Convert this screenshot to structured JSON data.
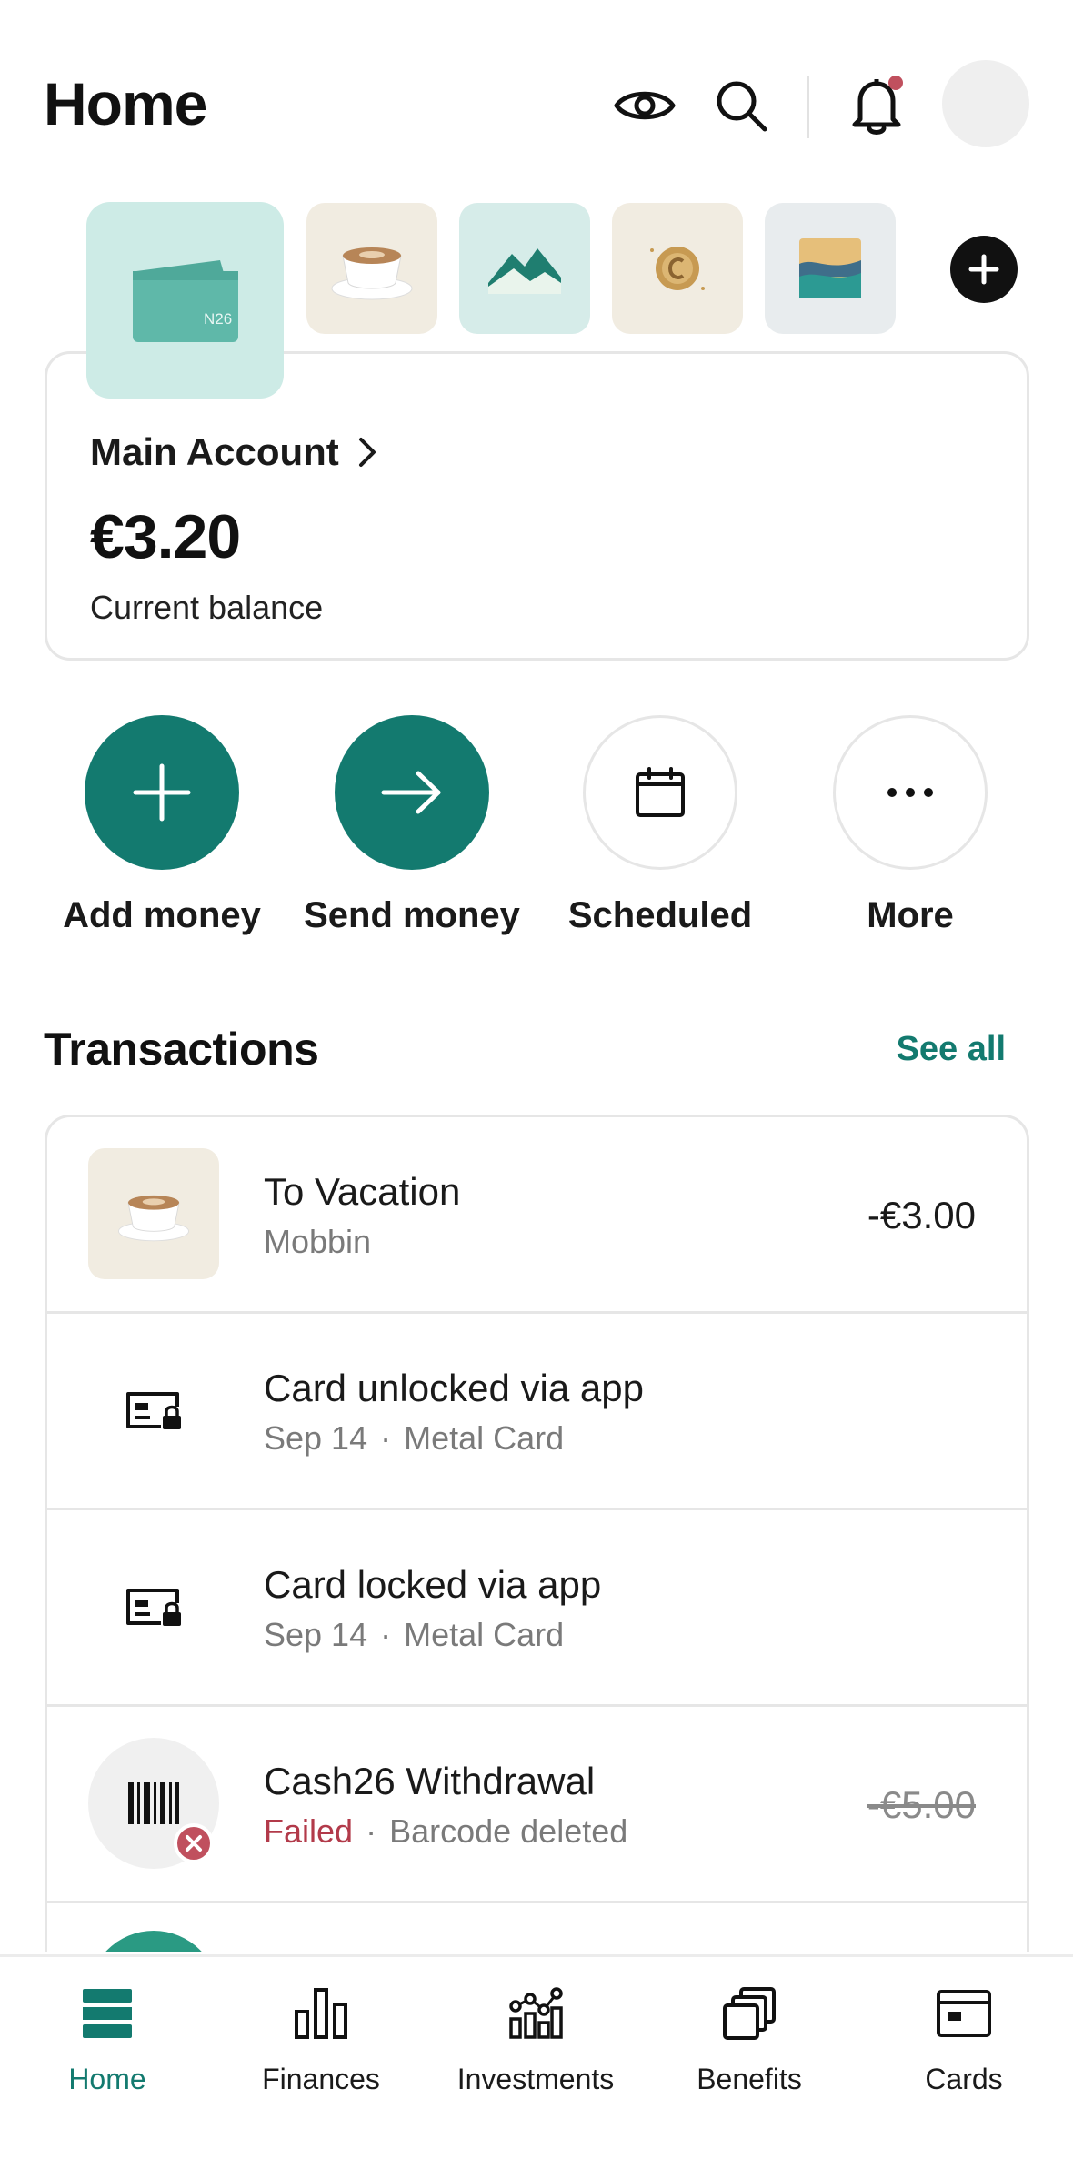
{
  "header": {
    "title": "Home",
    "icons": [
      "eye-icon",
      "search-icon",
      "bell-icon",
      "avatar"
    ],
    "notification_dot_color": "#c0505e"
  },
  "spaces": [
    {
      "name": "main-account",
      "icon": "wallet-icon",
      "bg": "#cdebe6",
      "wallet_mark": "N26"
    },
    {
      "name": "coffee",
      "icon": "coffee-cup-icon",
      "bg": "#f1ece1"
    },
    {
      "name": "mountains",
      "icon": "mountains-icon",
      "bg": "#d6ece9"
    },
    {
      "name": "coin",
      "icon": "coin-icon",
      "bg": "#f1ece1"
    },
    {
      "name": "landscape",
      "icon": "landscape-icon",
      "bg": "#e8ecee"
    }
  ],
  "account": {
    "name": "Main Account",
    "balance": "€3.20",
    "balance_label": "Current balance"
  },
  "actions": [
    {
      "label": "Add money",
      "icon": "plus-icon"
    },
    {
      "label": "Send money",
      "icon": "arrow-right-icon"
    },
    {
      "label": "Scheduled",
      "icon": "calendar-icon"
    },
    {
      "label": "More",
      "icon": "more-icon"
    }
  ],
  "transactions_section": {
    "title": "Transactions",
    "see_all": "See all"
  },
  "transactions": [
    {
      "title": "To Vacation",
      "subtitle": "Mobbin",
      "amount": "-€3.00",
      "icon": "coffee-cup-icon"
    },
    {
      "title": "Card unlocked via app",
      "date": "Sep 14",
      "sep": "·",
      "detail": "Metal Card",
      "icon": "card-lock-icon"
    },
    {
      "title": "Card locked via app",
      "date": "Sep 14",
      "sep": "·",
      "detail": "Metal Card",
      "icon": "card-lock-icon"
    },
    {
      "title": "Cash26 Withdrawal",
      "status": "Failed",
      "sep": "·",
      "detail": "Barcode deleted",
      "amount": "-€5.00",
      "icon": "barcode-icon"
    }
  ],
  "nav": [
    {
      "label": "Home",
      "icon": "home-icon",
      "active": true
    },
    {
      "label": "Finances",
      "icon": "bar-chart-icon"
    },
    {
      "label": "Investments",
      "icon": "investments-icon"
    },
    {
      "label": "Benefits",
      "icon": "benefits-icon"
    },
    {
      "label": "Cards",
      "icon": "card-icon"
    }
  ],
  "colors": {
    "accent": "#137a6f",
    "failed": "#b23a4a",
    "muted_text": "#7a7a7a",
    "border": "#e6e6e6"
  }
}
